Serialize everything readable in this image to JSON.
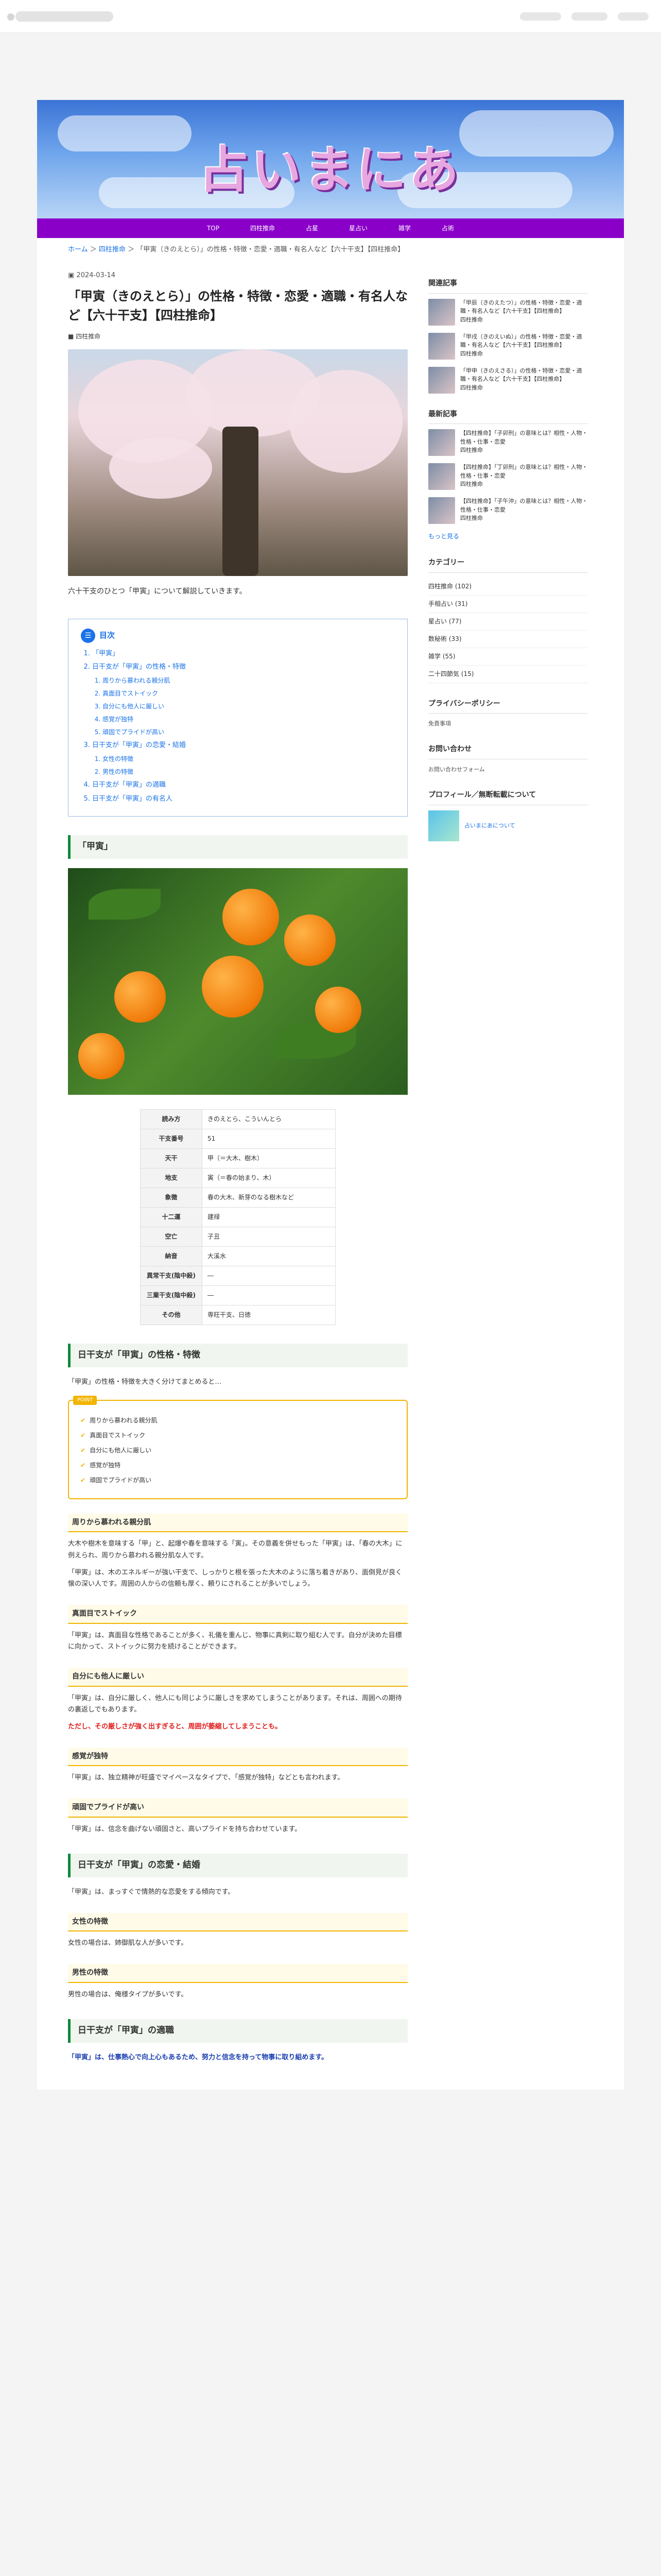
{
  "site": {
    "title": "占いまにあ"
  },
  "nav": [
    "TOP",
    "四柱推命",
    "占星",
    "星占い",
    "雑学",
    "占術"
  ],
  "breadcrumb": [
    "ホーム",
    "四柱推命",
    "「甲寅（きのえとら）」の性格・特徴・恋愛・適職・有名人など【六十干支】【四柱推命】"
  ],
  "article": {
    "date": "2024-03-14",
    "title": "「甲寅（きのえとら）」の性格・特徴・恋愛・適職・有名人など【六十干支】【四柱推命】",
    "category": "四柱推命",
    "intro": "六十干支のひとつ「甲寅」について解説していきます。",
    "toc_title": "目次",
    "toc": [
      {
        "label": "「甲寅」",
        "children": []
      },
      {
        "label": "日干支が「甲寅」の性格・特徴",
        "children": [
          "周りから慕われる親分肌",
          "真面目でストイック",
          "自分にも他人に厳しい",
          "感覚が独特",
          "頑固でプライドが高い"
        ]
      },
      {
        "label": "日干支が「甲寅」の恋愛・結婚",
        "children": [
          "女性の特徴",
          "男性の特徴"
        ]
      },
      {
        "label": "日干支が「甲寅」の適職",
        "children": []
      },
      {
        "label": "日干支が「甲寅」の有名人",
        "children": []
      }
    ],
    "sec1_title": "「甲寅」",
    "info_table": [
      [
        "読み方",
        "きのえとら、こういんとら"
      ],
      [
        "干支番号",
        "51"
      ],
      [
        "天干",
        "甲（＝大木、樹木）"
      ],
      [
        "地支",
        "寅（＝春の始まり、木）"
      ],
      [
        "象徴",
        "春の大木、新芽のなる樹木など"
      ],
      [
        "十二運",
        "建禄"
      ],
      [
        "空亡",
        "子丑"
      ],
      [
        "納音",
        "大溪水"
      ],
      [
        "異常干支(陰中殺)",
        "―"
      ],
      [
        "三業干支(陰中殺)",
        "―"
      ],
      [
        "その他",
        "専旺干支、日徳"
      ]
    ],
    "sec2_title": "日干支が「甲寅」の性格・特徴",
    "sec2_lead": "「甲寅」の性格・特徴を大きく分けてまとめると…",
    "point_badge": "POINT",
    "points": [
      "周りから慕われる親分肌",
      "真面目でストイック",
      "自分にも他人に厳しい",
      "感覚が独特",
      "頑固でプライドが高い"
    ],
    "sub1_title": "周りから慕われる親分肌",
    "sub1_p1": "大木や樹木を意味する「甲」と、起爆や春を意味する「寅」。その意義を併せもった「甲寅」は、「春の大木」に例えられ、周りから慕われる親分肌な人です。",
    "sub1_p2": "「甲寅」は、木のエネルギーが強い干支で、しっかりと根を張った大木のように落ち着きがあり、面倒見が良く懐の深い人です。周囲の人からの信頼も厚く、頼りにされることが多いでしょう。",
    "sub2_title": "真面目でストイック",
    "sub2_p1": "「甲寅」は、真面目な性格であることが多く、礼儀を重んじ、物事に真剣に取り組む人です。自分が決めた目標に向かって、ストイックに努力を続けることができます。",
    "sub3_title": "自分にも他人に厳しい",
    "sub3_p1": "「甲寅」は、自分に厳しく、他人にも同じように厳しさを求めてしまうことがあります。それは、周囲への期待の裏返しでもあります。",
    "sub3_p2": "ただし、その厳しさが強く出すぎると、周囲が萎縮してしまうことも。",
    "sub4_title": "感覚が独特",
    "sub4_p1": "「甲寅」は、独立精神が旺盛でマイペースなタイプで、「感覚が独特」などとも言われます。",
    "sub5_title": "頑固でプライドが高い",
    "sub5_p1": "「甲寅」は、信念を曲げない頑固さと、高いプライドを持ち合わせています。",
    "sec3_title": "日干支が「甲寅」の恋愛・結婚",
    "sec3_p1": "「甲寅」は、まっすぐで情熱的な恋愛をする傾向です。",
    "sub6_title": "女性の特徴",
    "sub6_p1": "女性の場合は、姉御肌な人が多いです。",
    "sub7_title": "男性の特徴",
    "sub7_p1": "男性の場合は、俺様タイプが多いです。",
    "sec4_title": "日干支が「甲寅」の適職",
    "sec4_p1": "「甲寅」は、仕事熱心で向上心もあるため、努力と信念を持って物事に取り組めます。"
  },
  "sidebar": {
    "related_title": "関連記事",
    "related": [
      {
        "title": "「甲辰（きのえたつ）」の性格・特徴・恋愛・適職・有名人など【六十干支】【四柱推命】",
        "meta": "四柱推命"
      },
      {
        "title": "「甲戌（きのえいぬ）」の性格・特徴・恋愛・適職・有名人など【六十干支】【四柱推命】",
        "meta": "四柱推命"
      },
      {
        "title": "「甲申（きのえさる）」の性格・特徴・恋愛・適職・有名人など【六十干支】【四柱推命】",
        "meta": "四柱推命"
      }
    ],
    "recent_title": "最新記事",
    "recent": [
      {
        "title": "【四柱推命】「子卯刑」の意味とは？相性・人物・性格・仕事・恋愛",
        "meta": "四柱推命"
      },
      {
        "title": "【四柱推命】「丁卯刑」の意味とは？相性・人物・性格・仕事・恋愛",
        "meta": "四柱推命"
      },
      {
        "title": "【四柱推命】「子午沖」の意味とは？相性・人物・性格・仕事・恋愛",
        "meta": "四柱推命"
      }
    ],
    "more": "もっと見る",
    "category_title": "カテゴリー",
    "categories": [
      "四柱推命 (102)",
      "手相占い (31)",
      "星占い (77)",
      "数秘術 (33)",
      "雑学 (55)",
      "二十四節気 (15)"
    ],
    "privacy_title": "プライバシーポリシー",
    "privacy_text": "免責事項",
    "contact_title": "お問い合わせ",
    "contact_text": "お問い合わせフォーム",
    "profile_title": "プロフィール／無断転載について",
    "profile_name": "占いまにあについて"
  }
}
